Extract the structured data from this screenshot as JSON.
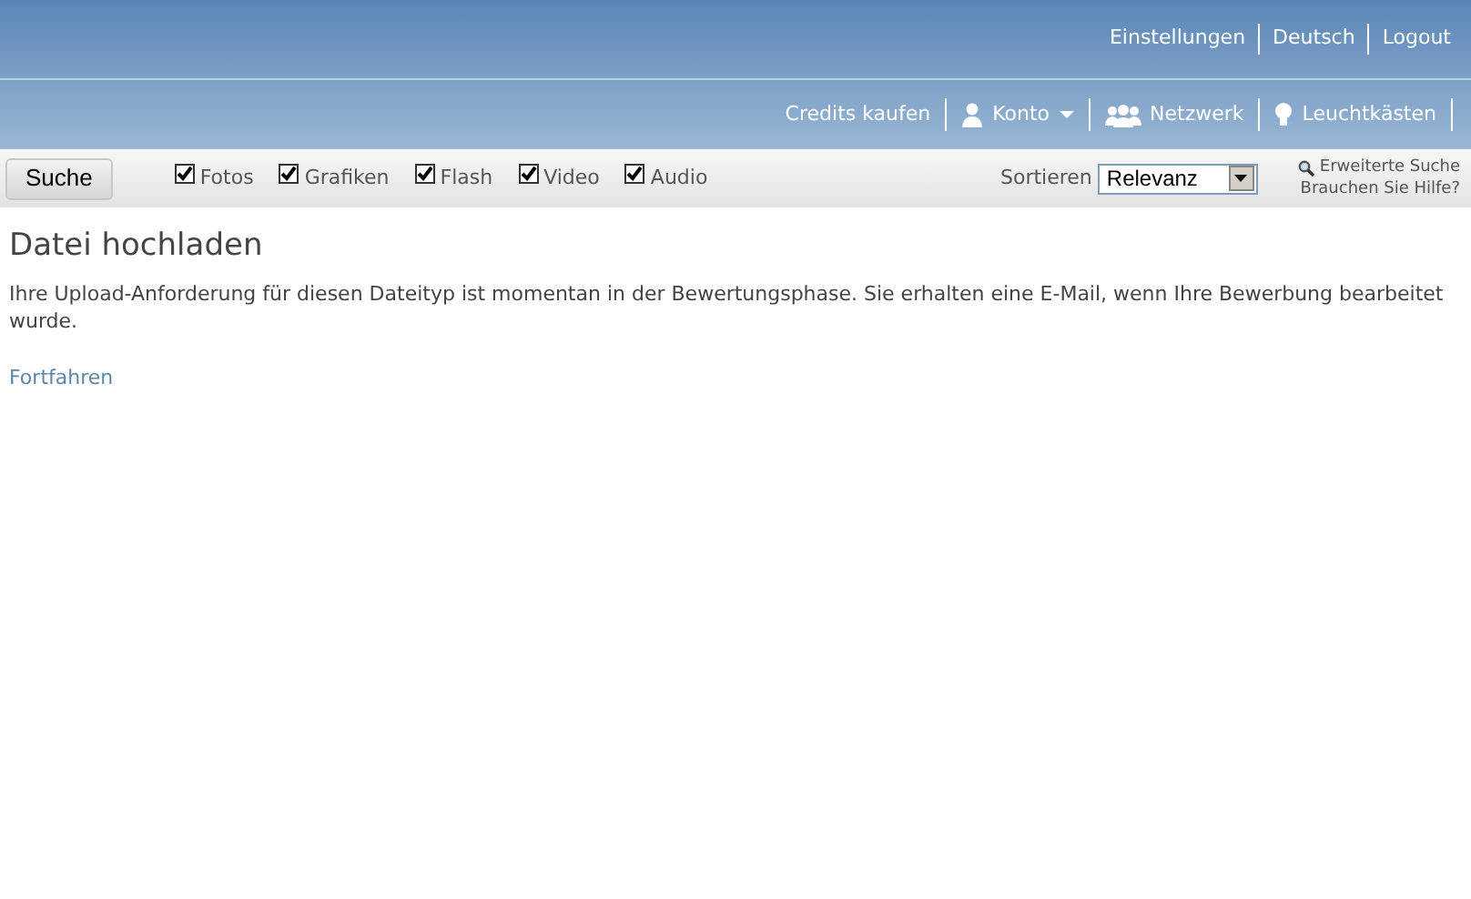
{
  "top_links": [
    "Einstellungen",
    "Deutsch",
    "Logout"
  ],
  "nav": [
    {
      "label": "Credits kaufen",
      "kind": "link"
    },
    {
      "label": "Konto",
      "kind": "menu"
    },
    {
      "label": "Netzwerk",
      "kind": "link"
    },
    {
      "label": "Leuchtkästen",
      "kind": "link"
    }
  ],
  "search_button": "Suche",
  "filters": [
    {
      "label": "Fotos",
      "checked": true
    },
    {
      "label": "Grafiken",
      "checked": true
    },
    {
      "label": "Flash",
      "checked": true
    },
    {
      "label": "Video",
      "checked": true
    },
    {
      "label": "Audio",
      "checked": true
    }
  ],
  "sort": {
    "label": "Sortieren",
    "value": "Relevanz"
  },
  "advanced_search": "Erweiterte Suche",
  "help": "Brauchen Sie Hilfe?",
  "content": {
    "title": "Datei hochladen",
    "message": "Ihre Upload-Anforderung für diesen Dateityp ist momentan in der Bewertungsphase. Sie erhalten eine E-Mail, wenn Ihre Bewerbung bearbeitet wurde.",
    "link": "Fortfahren"
  }
}
